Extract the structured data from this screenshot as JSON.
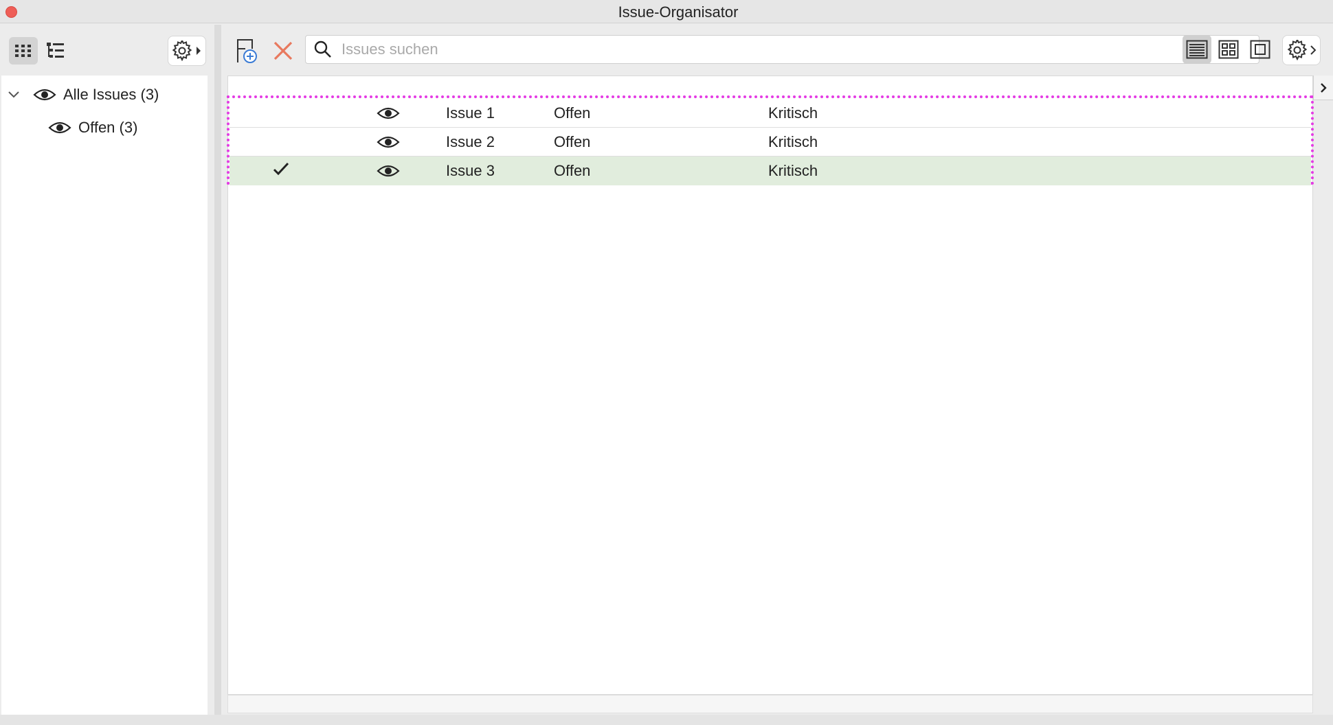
{
  "window": {
    "title": "Issue-Organisator"
  },
  "left_toolbar": {
    "buttons": [
      {
        "name": "grid-view-icon",
        "active": true
      },
      {
        "name": "tree-view-icon",
        "active": false
      },
      {
        "name": "gear-icon",
        "menu": true
      }
    ]
  },
  "sidebar": {
    "items": [
      {
        "label": "Alle Issues (3)",
        "expanded": true,
        "icon": "eye-icon",
        "level": 0
      },
      {
        "label": "Offen (3)",
        "icon": "eye-icon",
        "level": 1
      }
    ]
  },
  "toolbar": {
    "add_icon": "add-issue-icon",
    "delete_icon": "delete-icon",
    "search_placeholder": "Issues suchen",
    "search_value": "",
    "view_modes": [
      "list-view-icon",
      "grid-view-icon",
      "single-view-icon"
    ],
    "active_view": "list-view-icon"
  },
  "issues": {
    "rows": [
      {
        "checked": false,
        "visible": true,
        "name": "Issue 1",
        "status": "Offen",
        "priority": "Kritisch",
        "selected": false
      },
      {
        "checked": false,
        "visible": true,
        "name": "Issue 2",
        "status": "Offen",
        "priority": "Kritisch",
        "selected": false
      },
      {
        "checked": true,
        "visible": true,
        "name": "Issue 3",
        "status": "Offen",
        "priority": "Kritisch",
        "selected": true
      }
    ]
  },
  "colors": {
    "selected_row": "#e1eddd",
    "highlight_outline": "#e43be4",
    "close_button": "#ee5e57",
    "delete_icon": "#e8795e",
    "add_icon_accent": "#3a7bd5"
  }
}
